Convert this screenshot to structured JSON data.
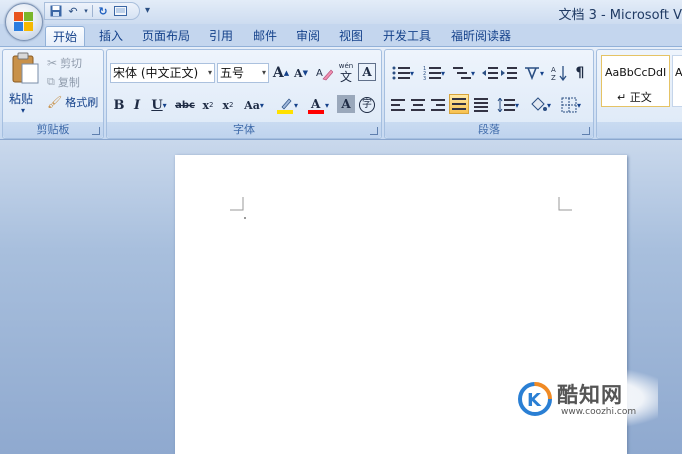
{
  "window": {
    "title": "文档 3 - Microsoft V"
  },
  "quick_access": {
    "items": [
      "save-icon",
      "undo-icon",
      "redo-icon",
      "print-preview-icon"
    ],
    "more": "▾"
  },
  "tabs": [
    "开始",
    "插入",
    "页面布局",
    "引用",
    "邮件",
    "审阅",
    "视图",
    "开发工具",
    "福昕阅读器"
  ],
  "active_tab": "开始",
  "clipboard": {
    "paste": "粘贴",
    "cut": "剪切",
    "copy": "复制",
    "format_painter": "格式刷",
    "label": "剪贴板"
  },
  "font": {
    "font_name": "宋体 (中文正文)",
    "font_size": "五号",
    "grow": "A",
    "shrink": "A",
    "bold": "B",
    "italic": "I",
    "underline": "U",
    "strikethrough": "abc",
    "subscript": "x",
    "superscript": "x",
    "change_case": "Aa",
    "char_shading": "A",
    "enclose": "字",
    "phonetic": "wén",
    "label": "字体"
  },
  "paragraph": {
    "label": "段落",
    "show_marks": "¶"
  },
  "styles": {
    "normal_preview": "AaBbCcDdI",
    "normal_name": "↵ 正文",
    "next_preview": "A"
  },
  "colors": {
    "highlight": "#ffe100",
    "font_color": "#ff0000"
  },
  "watermark": {
    "title": "酷知网",
    "url": "www.coozhi.com"
  }
}
